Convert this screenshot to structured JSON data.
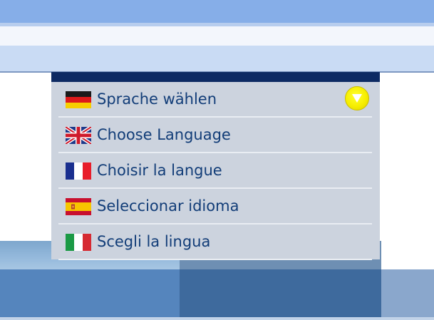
{
  "language_menu": {
    "items": [
      {
        "label": "Sprache wählen",
        "flag": "germany-flag"
      },
      {
        "label": "Choose Language",
        "flag": "united-kingdom-flag"
      },
      {
        "label": "Choisir la langue",
        "flag": "france-flag"
      },
      {
        "label": "Seleccionar idioma",
        "flag": "spain-flag"
      },
      {
        "label": "Scegli la lingua",
        "flag": "italy-flag"
      }
    ],
    "toggle_icon": "chevron-down-icon",
    "colors": {
      "menu_background": "#ccd3de",
      "menu_header": "#0d2a63",
      "item_text": "#123d78",
      "toggle_button": "#f6ee00"
    }
  }
}
